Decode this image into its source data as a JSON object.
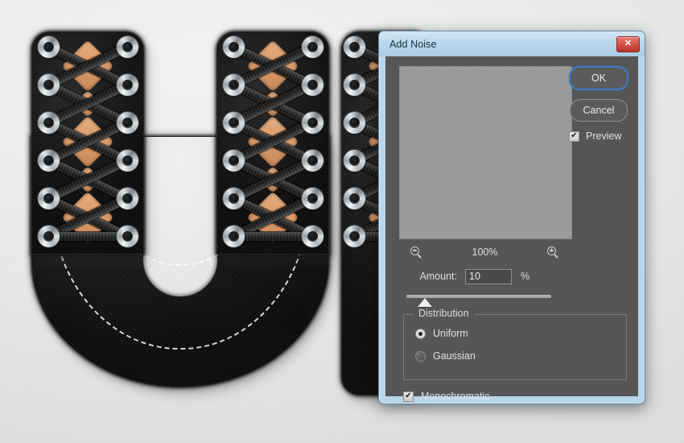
{
  "artwork": {
    "description": "Black fuzzy fabric letter U with silver eyelets and black shoe laces over tan leather",
    "letter": "U",
    "colors": {
      "background": "#e9ebeb",
      "fabric": "#141414",
      "lace": "#2a2a2a",
      "eyelet": "#c9ced1",
      "tan_leather": "#d99a6a",
      "stitch": "#ffffff"
    }
  },
  "dialog": {
    "title": "Add Noise",
    "close_icon": "✕",
    "preview": {
      "zoom_out_icon": "zoom-out-icon",
      "zoom_level": "100%",
      "zoom_in_icon": "zoom-in-icon"
    },
    "amount": {
      "label": "Amount:",
      "value": "10",
      "unit": "%"
    },
    "distribution": {
      "legend": "Distribution",
      "options": [
        {
          "label": "Uniform",
          "checked": true
        },
        {
          "label": "Gaussian",
          "checked": false
        }
      ]
    },
    "monochromatic": {
      "label": "Monochromatic",
      "checked": true,
      "check_glyph": "✔"
    },
    "buttons": {
      "ok": "OK",
      "cancel": "Cancel",
      "preview_label": "Preview",
      "preview_checked": true,
      "preview_check_glyph": "✔"
    },
    "colors": {
      "titlebar": "#bcd8ec",
      "body": "#565656",
      "accent": "#3f78c8",
      "close_button": "#d8554a"
    }
  }
}
